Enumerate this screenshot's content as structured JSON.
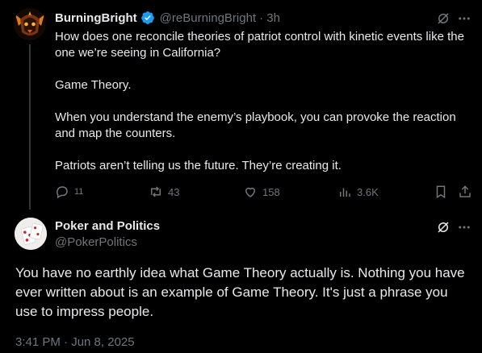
{
  "tweet": {
    "display_name": "BurningBright",
    "handle": "@reBurningBright",
    "time": "· 3h",
    "paragraphs": [
      "How does one reconcile theories of patriot control with kinetic events like the one we’re seeing in California?",
      "Game Theory.",
      "When you understand the enemy’s playbook, you can provoke the reaction and map the counters.",
      "Patriots aren’t telling us the future. They’re creating it."
    ],
    "replies": "11",
    "reposts": "43",
    "likes": "158",
    "views": "3.6K"
  },
  "reply": {
    "display_name": "Poker and Politics",
    "handle": "@PokerPolitics",
    "text": "You have no earthly idea what Game Theory actually is. Nothing you have ever written about is an example of Game Theory. It's just a phrase you use to impress people.",
    "timestamp": "3:41 PM · Jun 8, 2025"
  },
  "colors": {
    "background": "#000000",
    "text": "#e7e9ea",
    "muted": "#71767b",
    "verified": "#1d9bf0"
  },
  "icons": [
    "verified-badge-icon",
    "grok-icon",
    "more-icon",
    "reply-icon",
    "repost-icon",
    "like-icon",
    "views-icon",
    "bookmark-icon",
    "share-icon"
  ]
}
